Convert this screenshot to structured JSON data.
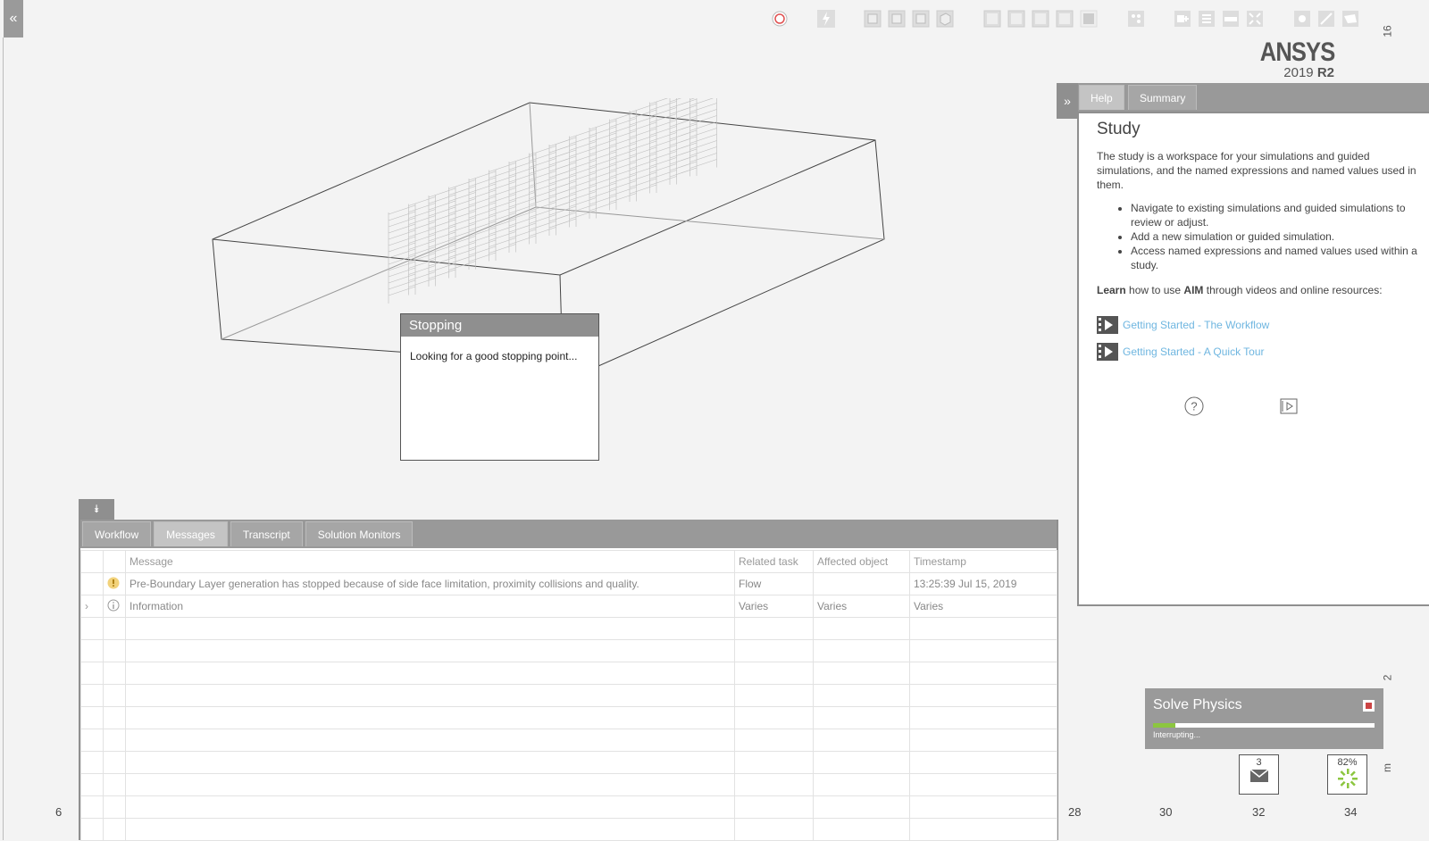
{
  "toolbar": {
    "icons": [
      "record-icon",
      "lightning-icon",
      "view-front-icon",
      "view-top-icon",
      "view-right-icon",
      "view-iso-icon",
      "layout-1-icon",
      "layout-2-icon",
      "layout-3-icon",
      "layout-4-icon",
      "layout-5-icon",
      "mesh-icon",
      "add-object-icon",
      "list-icon",
      "ruler-icon",
      "fit-icon",
      "light-icon",
      "line-icon",
      "plane-icon"
    ]
  },
  "brand": {
    "name": "ANSYS",
    "version": "2019",
    "release": "R2"
  },
  "stopping_dialog": {
    "title": "Stopping",
    "message": "Looking for a good stopping point..."
  },
  "bottom_panel": {
    "tabs": [
      "Workflow",
      "Messages",
      "Transcript",
      "Solution Monitors"
    ],
    "active_tab": "Messages",
    "columns": [
      "Message",
      "Related task",
      "Affected object",
      "Timestamp"
    ],
    "rows": [
      {
        "icon": "warning-icon",
        "message": "Pre-Boundary Layer generation has stopped because of side face limitation, proximity collisions and quality.",
        "task": "Flow",
        "object": "",
        "timestamp": "13:25:39 Jul 15, 2019"
      },
      {
        "icon": "info-icon",
        "message": "Information",
        "task": "Varies",
        "object": "Varies",
        "timestamp": "Varies"
      }
    ]
  },
  "help_panel": {
    "tabs": [
      "Help",
      "Summary"
    ],
    "active_tab": "Help",
    "title": "Study",
    "intro": "The study is a workspace for your simulations and guided simulations, and the named expressions and named values used in them.",
    "bullets": [
      "Navigate to existing simulations and guided simulations to review or adjust.",
      "Add a new simulation or guided simulation.",
      "Access named expressions and named values used within a study."
    ],
    "learn_bold": "Learn",
    "learn_mid": " how to use ",
    "learn_aim": "AIM",
    "learn_rest": " through videos and online resources:",
    "links": [
      "Getting Started - The Workflow",
      "Getting Started - A Quick Tour"
    ]
  },
  "solve": {
    "title": "Solve Physics",
    "status": "Interrupting...",
    "progress": 0.1
  },
  "notifications": {
    "count": "3",
    "percent": "82%"
  },
  "ruler": {
    "bottom": [
      "6",
      "28",
      "30",
      "32",
      "34"
    ],
    "right": [
      "16",
      "2",
      "m"
    ]
  },
  "colors": {
    "accent": "#8cc63f",
    "link": "#6fb6e0",
    "panel": "#999999"
  }
}
